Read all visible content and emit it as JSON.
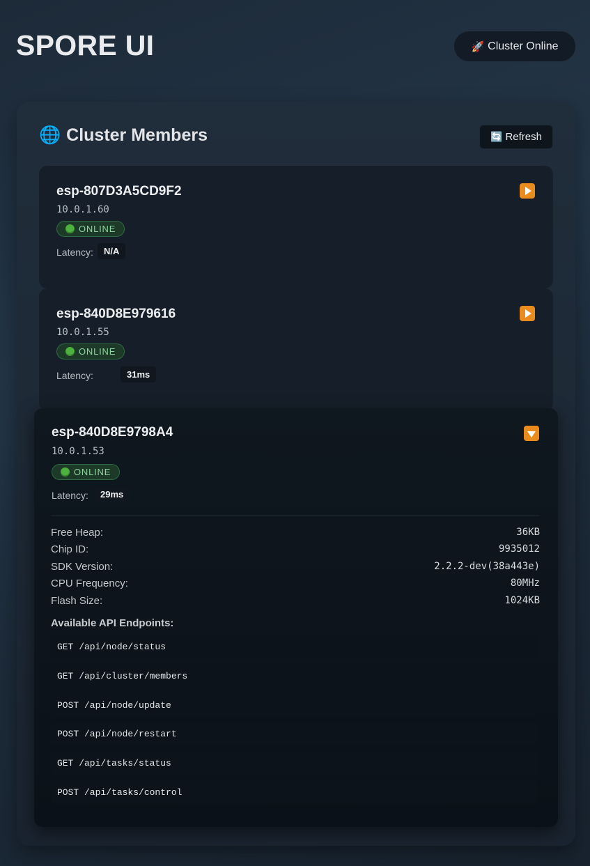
{
  "header": {
    "app_title": "SPORE UI",
    "cluster_status": {
      "icon": "rocket-icon",
      "label": "Cluster Online"
    }
  },
  "panel": {
    "title_icon": "globe-icon",
    "title": "Cluster Members",
    "refresh": {
      "icon": "refresh-icon",
      "label": "Refresh"
    }
  },
  "members": [
    {
      "name": "esp-807D3A5CD9F2",
      "ip": "10.0.1.60",
      "status": "ONLINE",
      "latency_label": "Latency:",
      "latency": "N/A",
      "expanded": false,
      "toggle_icon": "expand-arrow-icon"
    },
    {
      "name": "esp-840D8E979616",
      "ip": "10.0.1.55",
      "status": "ONLINE",
      "latency_label": "Latency:",
      "latency": "31ms",
      "expanded": false,
      "toggle_icon": "expand-arrow-icon"
    },
    {
      "name": "esp-840D8E9798A4",
      "ip": "10.0.1.53",
      "status": "ONLINE",
      "latency_label": "Latency:",
      "latency": "29ms",
      "expanded": true,
      "toggle_icon": "collapse-arrow-icon",
      "details": [
        {
          "label": "Free Heap:",
          "value": "36KB"
        },
        {
          "label": "Chip ID:",
          "value": "9935012"
        },
        {
          "label": "SDK Version:",
          "value": "2.2.2-dev(38a443e)"
        },
        {
          "label": "CPU Frequency:",
          "value": "80MHz"
        },
        {
          "label": "Flash Size:",
          "value": "1024KB"
        }
      ],
      "api_title": "Available API Endpoints:",
      "endpoints": [
        "GET /api/node/status",
        "GET /api/cluster/members",
        "POST /api/node/update",
        "POST /api/node/restart",
        "GET /api/tasks/status",
        "POST /api/tasks/control"
      ]
    }
  ],
  "colors": {
    "background": "#1f2d3b",
    "online_badge": "#1c3a27",
    "online_text": "#8fd39f",
    "toggle_orange": "#e98b1d"
  }
}
